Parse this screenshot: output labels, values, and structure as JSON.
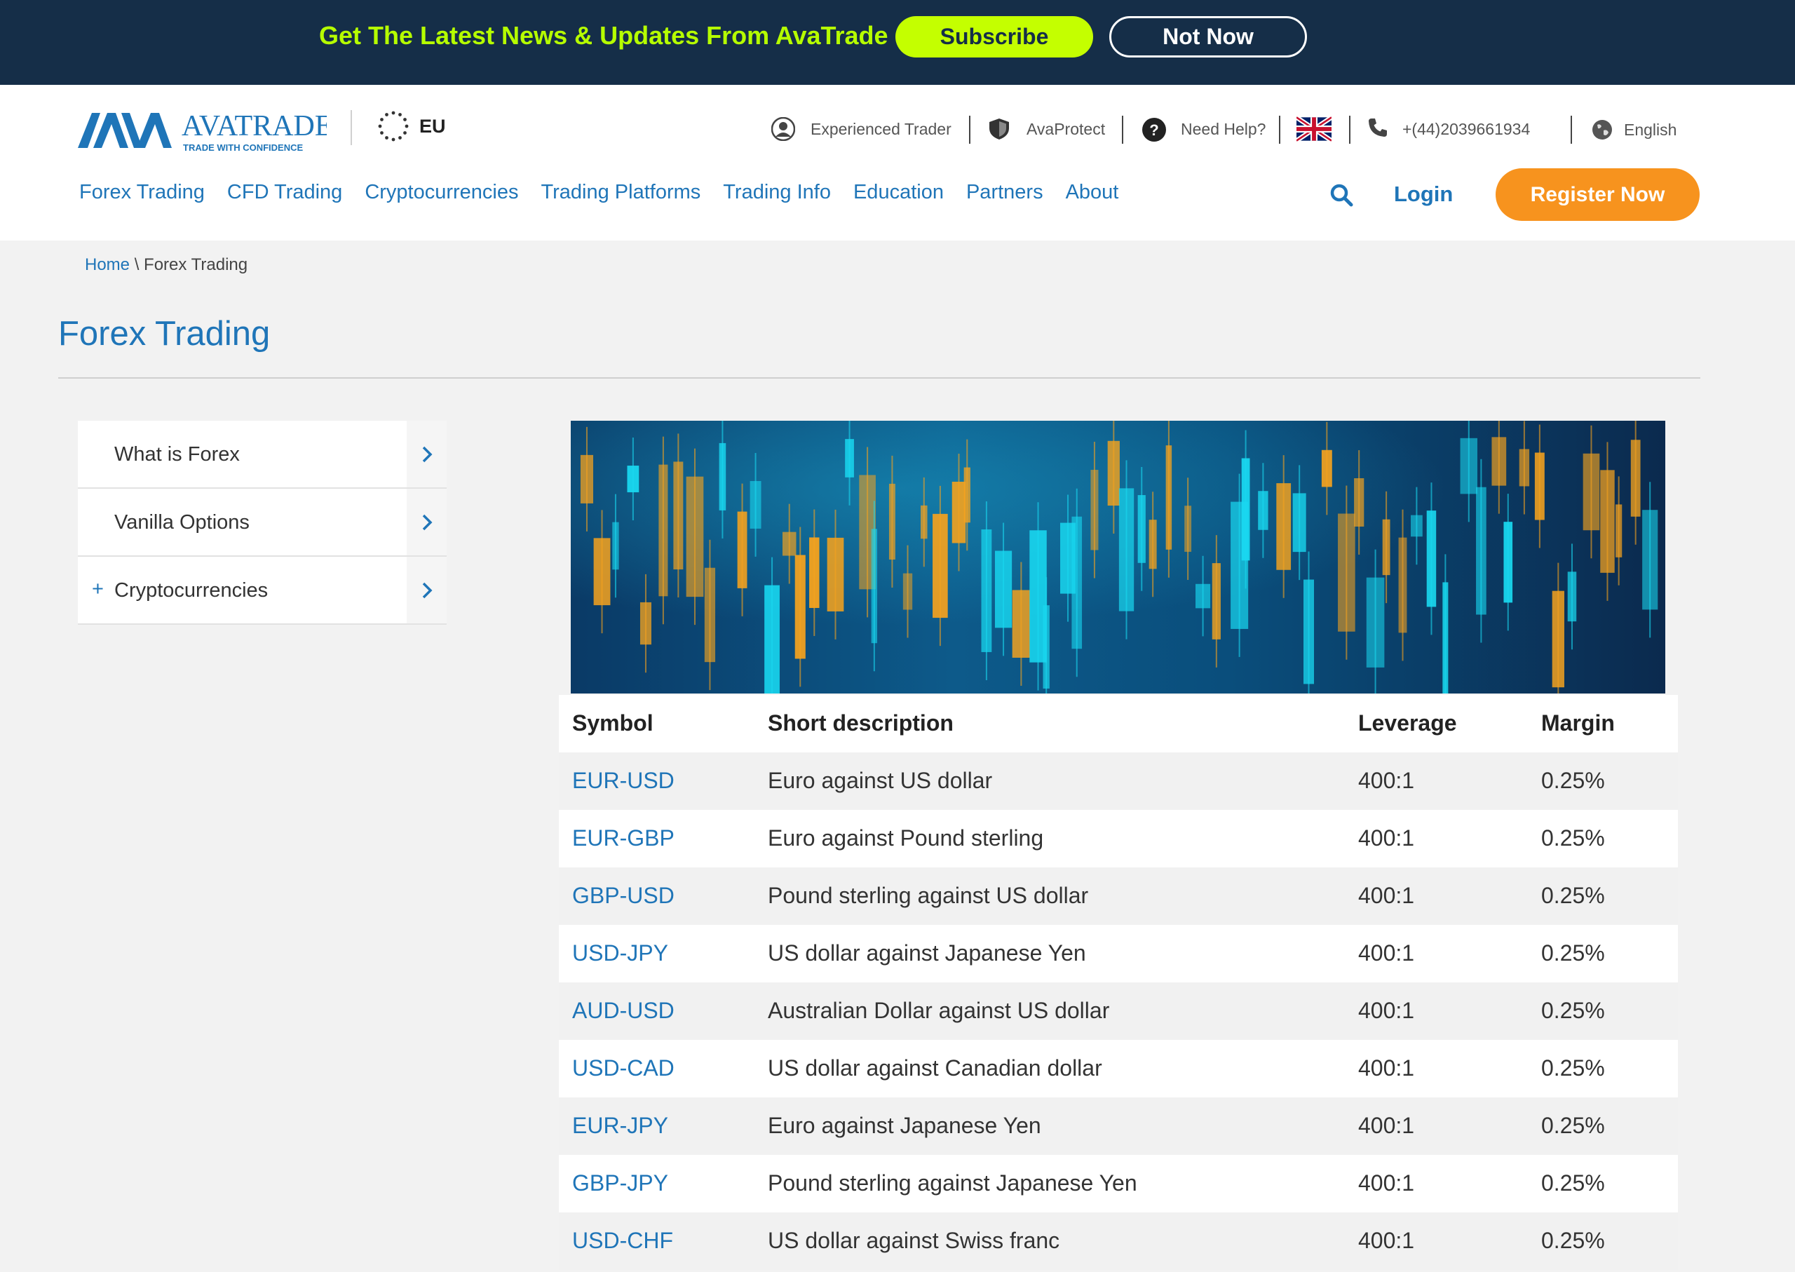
{
  "banner": {
    "text": "Get The Latest News & Updates From AvaTrade",
    "subscribe_label": "Subscribe",
    "not_now_label": "Not Now"
  },
  "header": {
    "logo_name": "AVATRADE",
    "logo_tagline": "TRADE WITH CONFIDENCE",
    "region": "EU",
    "utility": {
      "experienced": "Experienced Trader",
      "avaprotect": "AvaProtect",
      "help": "Need Help?",
      "phone": "+(44)2039661934",
      "language": "English"
    },
    "nav": [
      "Forex Trading",
      "CFD Trading",
      "Cryptocurrencies",
      "Trading Platforms",
      "Trading Info",
      "Education",
      "Partners",
      "About"
    ],
    "login_label": "Login",
    "register_label": "Register Now"
  },
  "breadcrumb": {
    "home": "Home",
    "separator": " \\ ",
    "current": "Forex Trading"
  },
  "page": {
    "title": "Forex Trading"
  },
  "sidebar": {
    "items": [
      {
        "label": "What is Forex",
        "prefix": ""
      },
      {
        "label": "Vanilla Options",
        "prefix": ""
      },
      {
        "label": "Cryptocurrencies",
        "prefix": "+"
      }
    ]
  },
  "table": {
    "headers": [
      "Symbol",
      "Short description",
      "Leverage",
      "Margin"
    ],
    "rows": [
      [
        "EUR-USD",
        "Euro against US dollar",
        "400:1",
        "0.25%"
      ],
      [
        "EUR-GBP",
        "Euro against Pound sterling",
        "400:1",
        "0.25%"
      ],
      [
        "GBP-USD",
        "Pound sterling against US dollar",
        "400:1",
        "0.25%"
      ],
      [
        "USD-JPY",
        "US dollar against Japanese Yen",
        "400:1",
        "0.25%"
      ],
      [
        "AUD-USD",
        "Australian Dollar against US dollar",
        "400:1",
        "0.25%"
      ],
      [
        "USD-CAD",
        "US dollar against Canadian dollar",
        "400:1",
        "0.25%"
      ],
      [
        "EUR-JPY",
        "Euro against Japanese Yen",
        "400:1",
        "0.25%"
      ],
      [
        "GBP-JPY",
        "Pound sterling against Japanese Yen",
        "400:1",
        "0.25%"
      ],
      [
        "USD-CHF",
        "US dollar against Swiss franc",
        "400:1",
        "0.25%"
      ]
    ]
  },
  "colors": {
    "banner_bg": "#152e48",
    "accent_green": "#c4ff00",
    "link_blue": "#1f75b8",
    "register_orange": "#f7931e"
  },
  "icons": [
    "user-icon",
    "shield-icon",
    "help-icon",
    "uk-flag-icon",
    "phone-icon",
    "globe-icon",
    "search-icon",
    "chevron-right-icon",
    "eu-stars-icon"
  ]
}
